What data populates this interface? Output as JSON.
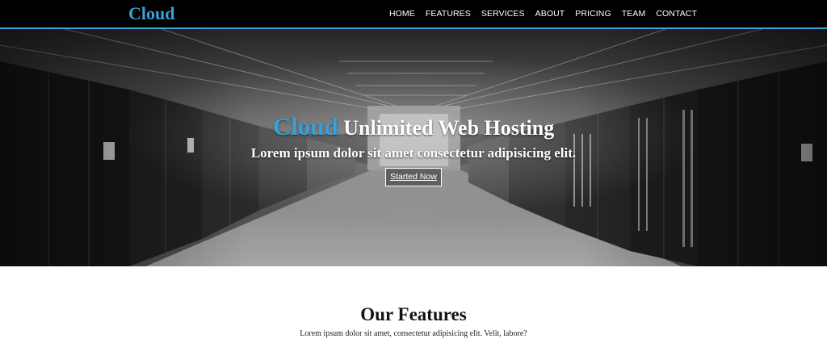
{
  "nav": {
    "brand": "Cloud",
    "links": [
      "HOME",
      "FEATURES",
      "SERVICES",
      "ABOUT",
      "PRICING",
      "TEAM",
      "CONTACT"
    ]
  },
  "hero": {
    "title_accent": "Cloud",
    "title_rest": "Unlimited Web Hosting",
    "subtitle": "Lorem ipsum dolor sit amet consectetur adipisicing elit.",
    "cta_label": "Started Now"
  },
  "features": {
    "heading": "Our Features",
    "description": "Lorem ipsum dolor sit amet, consectetur adipisicing elit. Velit, labore?"
  },
  "colors": {
    "accent": "#3aa1d8",
    "navbar_bg": "#000000",
    "text_light": "#ffffff"
  }
}
